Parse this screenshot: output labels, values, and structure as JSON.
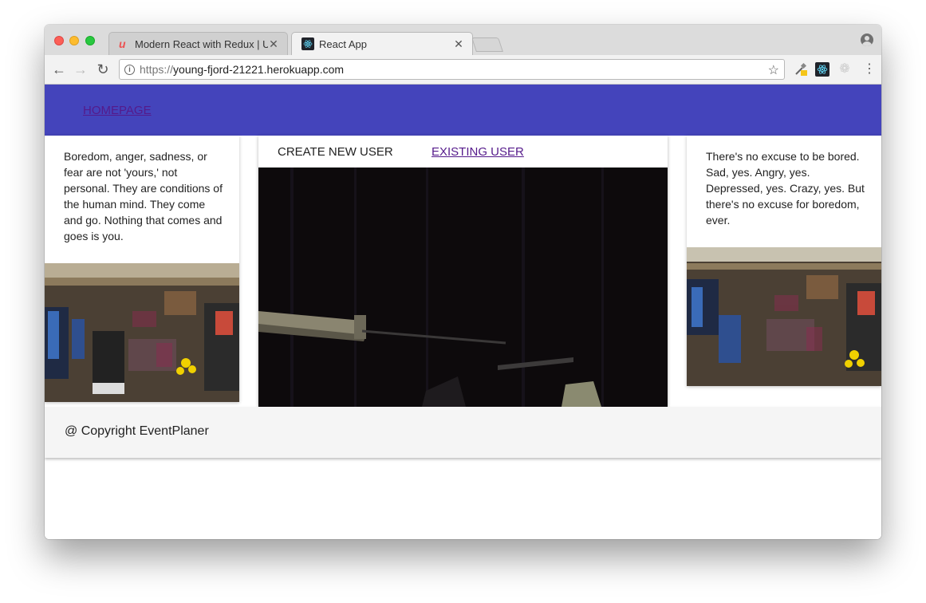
{
  "browser": {
    "tabs": [
      {
        "title": "Modern React with Redux | Ud",
        "active": false
      },
      {
        "title": "React App",
        "active": true
      }
    ],
    "url_scheme": "https://",
    "url_host": "young-fjord-21221.herokuapp.com",
    "icons": [
      "back-icon",
      "forward-icon",
      "reload-icon",
      "info-icon",
      "star-icon",
      "profile-icon",
      "menu-icon"
    ]
  },
  "page": {
    "header": {
      "home_link": "HOMEPAGE",
      "color": "#4444bb"
    },
    "left_quote": "Boredom, anger, sadness, or fear are not 'yours,' not personal. They are conditions of the human mind. They come and go. Nothing that comes and goes is you.",
    "right_quote": "There's no excuse to be bored. Sad, yes. Angry, yes. Depressed, yes. Crazy, yes. But there's no excuse for boredom, ever.",
    "center_tabs": {
      "create": "CREATE NEW USER",
      "existing": "EXISTING USER"
    },
    "footer": {
      "copyright": "@ Copyright EventPlaner"
    }
  }
}
